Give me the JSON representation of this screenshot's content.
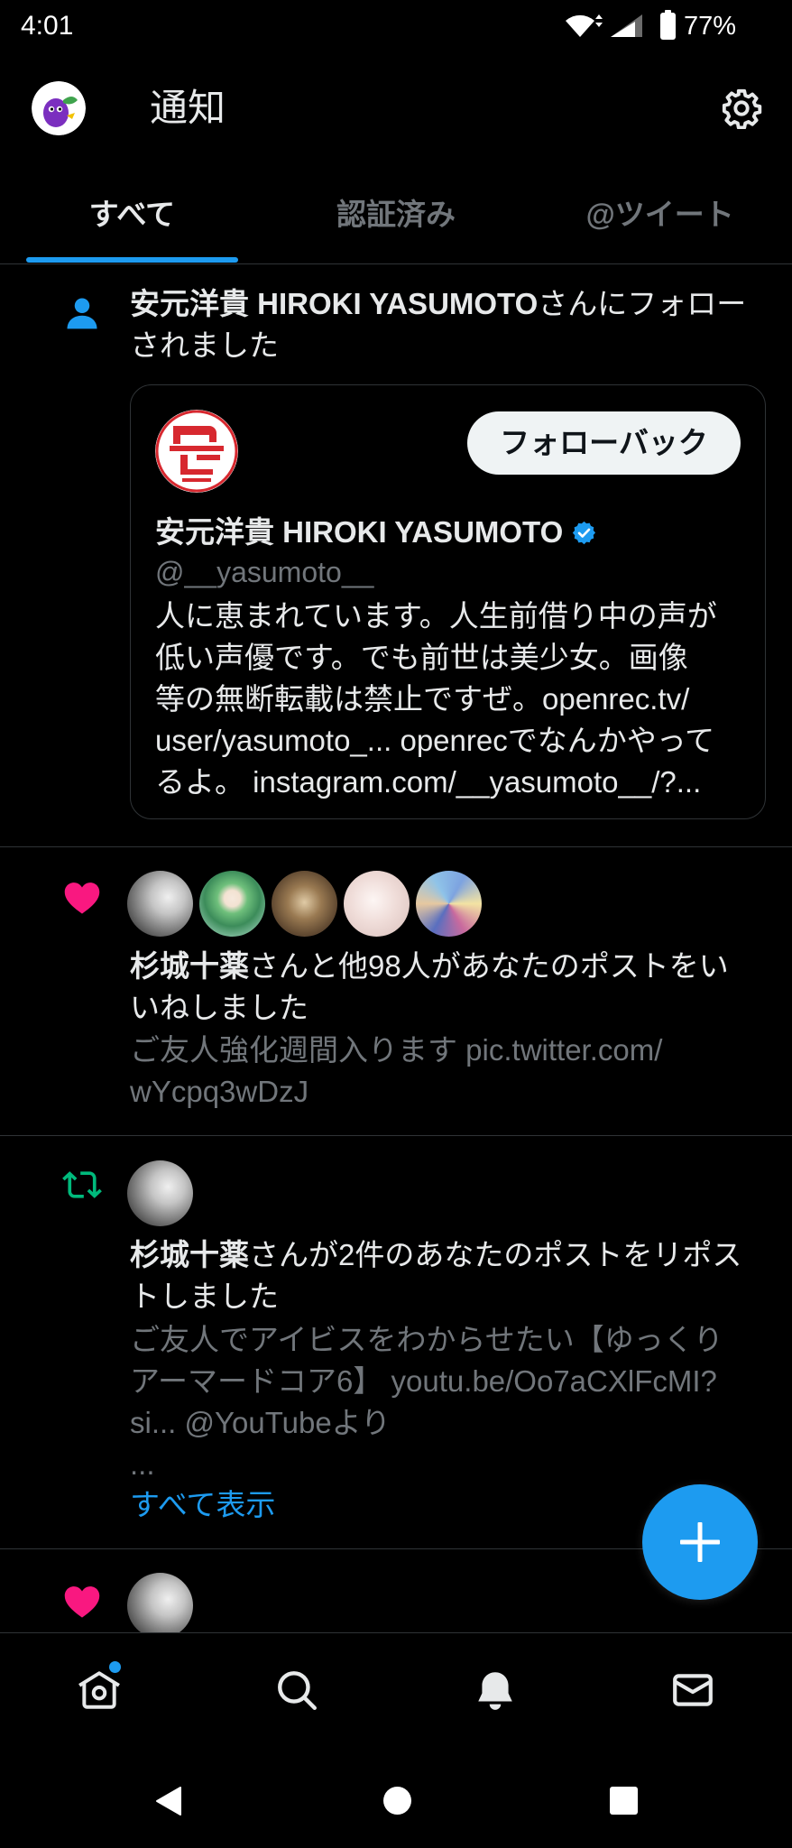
{
  "status_bar": {
    "time": "4:01",
    "battery_percent": "77%",
    "icons": [
      "wifi-icon",
      "signal-icon",
      "battery-icon"
    ]
  },
  "header": {
    "title": "通知",
    "settings_icon": "gear-icon"
  },
  "tabs": [
    {
      "label": "すべて",
      "selected": true
    },
    {
      "label": "認証済み",
      "selected": false
    },
    {
      "label": "@ツイート",
      "selected": false
    }
  ],
  "notifications": [
    {
      "icon": "person-icon",
      "name": "安元洋貴 HIROKI YASUMOTO",
      "message_lines": [
        "さんにフォロー",
        "されました"
      ],
      "card": {
        "display_name": "安元洋貴 HIROKI YASUMOTO",
        "verified": true,
        "handle": "@__yasumoto__",
        "follow_back_label": "フォローバック",
        "bio_lines": [
          "人に恵まれています。人生前借り中の声が",
          "低い声優です。でも前世は美少女。画像",
          "等の無断転載は禁止ですぜ。openrec.tv/",
          "user/yasumoto_... openrecでなんかやって",
          "るよ。 instagram.com/__yasumoto__/?..."
        ]
      }
    },
    {
      "icon": "heart-icon",
      "name": "杉城十薬",
      "message_lines": [
        "さんと他98人があなたのポストをい",
        "いねしました"
      ],
      "snippet_lines": [
        "ご友人強化週間入ります pic.twitter.com/",
        "wYcpq3wDzJ"
      ]
    },
    {
      "icon": "repost-icon",
      "name": "杉城十薬",
      "message_lines": [
        "さんが2件のあなたのポストをリポス",
        "トしました"
      ],
      "snippet_lines": [
        "ご友人でアイビスをわからせたい【ゆっくり",
        "アーマードコア6】 youtu.be/Oo7aCXlFcMI?",
        "si... @YouTubeより",
        "..."
      ],
      "show_more_label": "すべて表示"
    },
    {
      "icon": "heart-icon"
    }
  ],
  "fab": {
    "icon": "plus-icon"
  },
  "bottom_nav": [
    {
      "icon": "home-icon",
      "has_new_dot": true
    },
    {
      "icon": "search-icon"
    },
    {
      "icon": "bell-icon",
      "active": true
    },
    {
      "icon": "mail-icon"
    }
  ],
  "system_nav": [
    "back-icon",
    "home-circle-icon",
    "recents-icon"
  ],
  "colors": {
    "background": "#000000",
    "text": "#e7e9ea",
    "secondary_text": "#71767b",
    "accent": "#1d9bf0",
    "like": "#f91880",
    "repost": "#00ba7c",
    "divider": "#2f3336"
  }
}
